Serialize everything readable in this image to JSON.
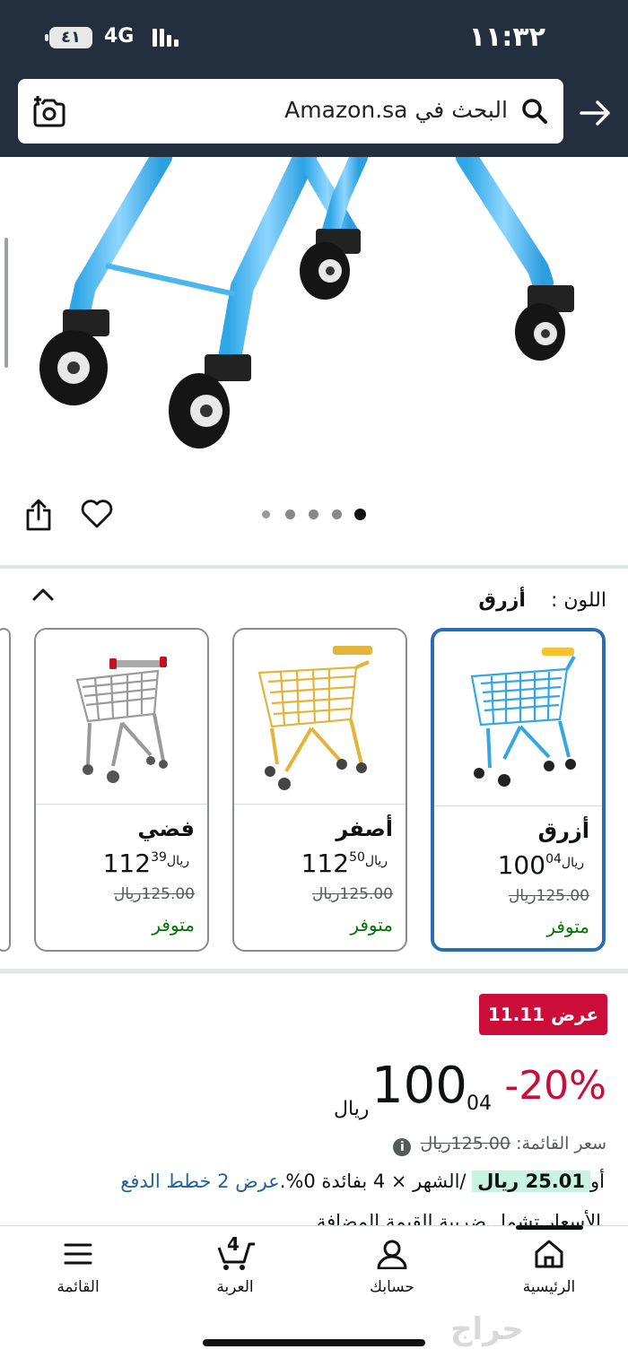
{
  "status_bar": {
    "battery": "٤١",
    "network": "4G",
    "time": "١١:٣٢"
  },
  "search": {
    "placeholder": "البحث في Amazon.sa"
  },
  "gallery": {
    "dots_count": 5,
    "active_dot": 5
  },
  "color_selector": {
    "label": "اللون :",
    "selected": "أزرق",
    "options": [
      {
        "name": "أزرق",
        "whole": "100",
        "fraction": "04",
        "currency": "ريال",
        "list_price": "125.00ريال",
        "availability": "متوفر",
        "selected": true
      },
      {
        "name": "أصفر",
        "whole": "112",
        "fraction": "50",
        "currency": "ريال",
        "list_price": "125.00ريال",
        "availability": "متوفر",
        "selected": false
      },
      {
        "name": "فضي",
        "whole": "112",
        "fraction": "39",
        "currency": "ريال",
        "list_price": "125.00ريال",
        "availability": "متوفر",
        "selected": false
      }
    ]
  },
  "deal": {
    "badge": "عرض 11.11",
    "discount": "-20%",
    "price_whole": "100",
    "price_fraction": "04",
    "currency": "ريال",
    "list_price_label": "سعر القائمة:",
    "list_price_value": "125.00ريال",
    "installment_prefix": "أو",
    "installment_amount": "25.01 ريال",
    "installment_text": "/الشهر × 4 بفائدة 0%.",
    "installment_link": "عرض 2 خطط الدفع",
    "tax_note": "الأسعار تشمل ضريبة القيمة المضافة"
  },
  "bottom_nav": {
    "home": "الرئيسية",
    "account": "حسابك",
    "cart": "العربة",
    "cart_count": "4",
    "menu": "القائمة"
  },
  "watermark": "حراج",
  "colors": {
    "header_bg": "#232f3e",
    "deal_red": "#cc0c39",
    "selected_border": "#2a6db4",
    "in_stock": "#007600",
    "link": "#2162a1"
  }
}
